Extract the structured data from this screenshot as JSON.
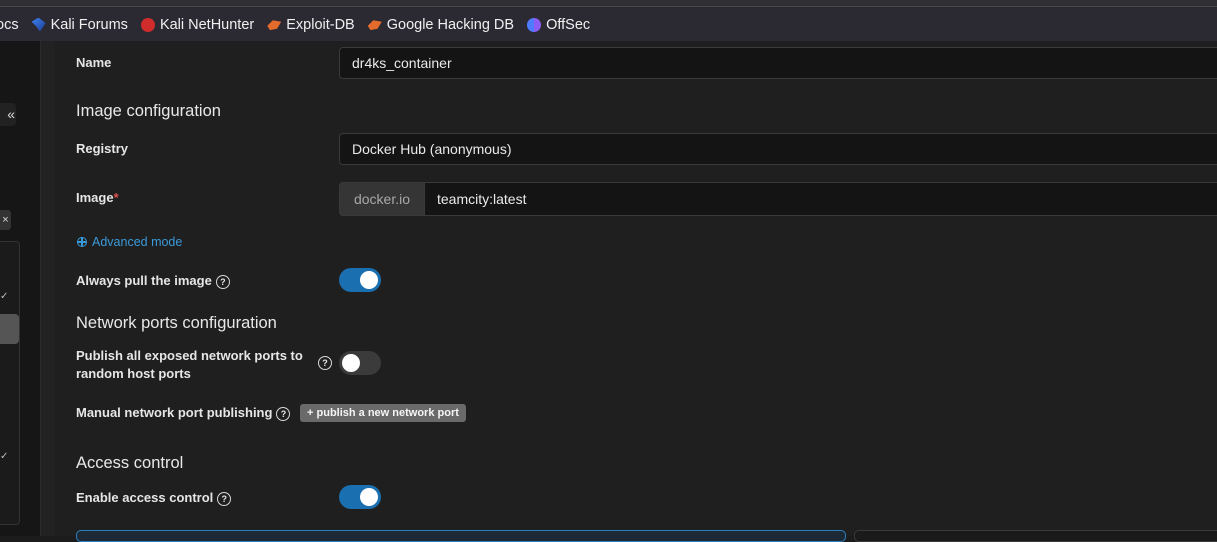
{
  "bookmarks": [
    {
      "label": "ocs",
      "icon": "none"
    },
    {
      "label": "Kali Forums",
      "icon": "kali-dragon-icon"
    },
    {
      "label": "Kali NetHunter",
      "icon": "nethunter-icon"
    },
    {
      "label": "Exploit-DB",
      "icon": "exploit-db-icon"
    },
    {
      "label": "Google Hacking DB",
      "icon": "ghdb-icon"
    },
    {
      "label": "OffSec",
      "icon": "offsec-icon"
    }
  ],
  "sidebar": {
    "collapse_glyph": "«",
    "close_glyph": "×"
  },
  "form": {
    "name_label": "Name",
    "name_value": "dr4ks_container",
    "image_config_heading": "Image configuration",
    "registry_label": "Registry",
    "registry_value": "Docker Hub (anonymous)",
    "image_label": "Image",
    "image_required_mark": "*",
    "image_prefix": "docker.io",
    "image_value": "teamcity:latest",
    "advanced_mode_link": "Advanced mode",
    "always_pull_label": "Always pull the image",
    "always_pull_on": true,
    "network_heading": "Network ports configuration",
    "publish_all_label_line1": "Publish all exposed network ports to",
    "publish_all_label_line2": "random host ports",
    "publish_all_on": false,
    "manual_publish_label": "Manual network port publishing",
    "publish_new_port_button": "publish a new network port",
    "publish_new_port_plus": "+",
    "access_control_heading": "Access control",
    "enable_access_label": "Enable access control",
    "enable_access_on": true,
    "help_glyph": "?"
  },
  "colors": {
    "accent": "#1a6fb0",
    "link": "#3a9ad9",
    "required": "#e04e4e"
  }
}
